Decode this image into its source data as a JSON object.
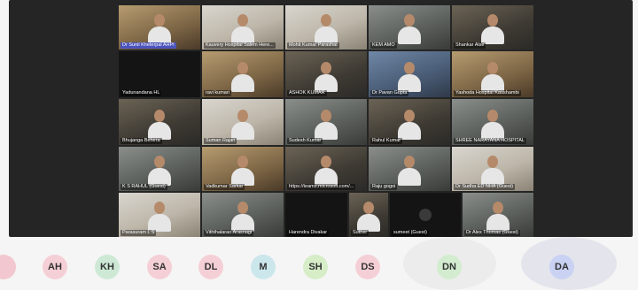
{
  "participants": [
    {
      "name": "Dr Sunil Kheterpal AHPI"
    },
    {
      "name": "Kauvery Hospital Salem Here..."
    },
    {
      "name": "Mohit Kumar Parashar"
    },
    {
      "name": "KEM AMO"
    },
    {
      "name": "Shankar Alse"
    },
    {
      "name": "Yadunandana HL"
    },
    {
      "name": "ravi kumari"
    },
    {
      "name": "ASHOK KUMAR"
    },
    {
      "name": "Dr Pavan Gupta"
    },
    {
      "name": "Yashoda Hospital Kaushambi"
    },
    {
      "name": "Bhujanga Behera"
    },
    {
      "name": "Suman Rajan"
    },
    {
      "name": "Sudesh Kumar"
    },
    {
      "name": "Rahul Kumar"
    },
    {
      "name": "SHREE NARAYANA HOSPITAL"
    },
    {
      "name": "K S RAHUL (Guest)"
    },
    {
      "name": "Vadkumar Sarkar"
    },
    {
      "name": "https://teams.microsoft.com/..."
    },
    {
      "name": "Raju gogoi"
    },
    {
      "name": "Dr Sudha ED NHA (Guest)"
    },
    {
      "name": "Parasuram L S"
    },
    {
      "name": "Viththalarao Arasnagi"
    },
    {
      "name": "Harendra Divakar"
    },
    {
      "name": "Suther"
    },
    {
      "name": "sumeet (Guest)"
    },
    {
      "name": "Dr Alex Thomas (Guest)"
    }
  ],
  "avatars": [
    {
      "initials": "",
      "color": "#f2c7cf"
    },
    {
      "initials": "AH",
      "color": "#f5cfd6"
    },
    {
      "initials": "KH",
      "color": "#cde9d6"
    },
    {
      "initials": "SA",
      "color": "#f5cfd6"
    },
    {
      "initials": "DL",
      "color": "#f5cfd6"
    },
    {
      "initials": "M",
      "color": "#cbe7ec"
    },
    {
      "initials": "SH",
      "color": "#d6edc7"
    },
    {
      "initials": "DS",
      "color": "#f5cfd6"
    },
    {
      "initials": "DN",
      "color": "#d3ecd0"
    },
    {
      "initials": "DA",
      "color": "#c9d2f2"
    }
  ]
}
